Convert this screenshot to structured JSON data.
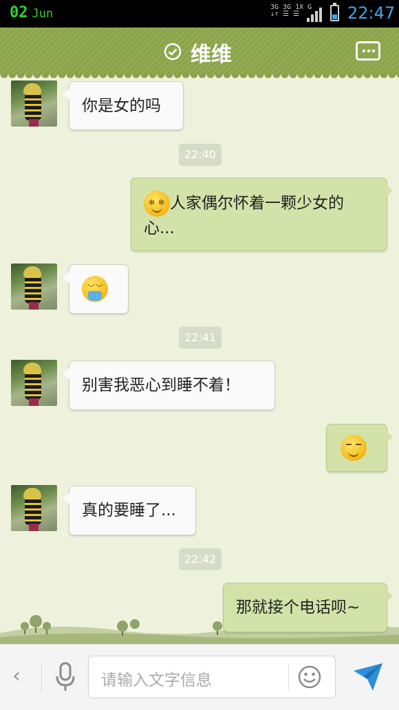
{
  "status_bar": {
    "day": "02",
    "month": "Jun",
    "network": "3G 3G 1X G",
    "time": "22:47"
  },
  "header": {
    "title": "维维",
    "menu_icon": "more-dots-icon",
    "verified_icon": "check-circle-icon",
    "accent": "#8aa34a"
  },
  "messages": [
    {
      "side": "left",
      "text": "你是女的吗"
    },
    {
      "timestamp": "22:40"
    },
    {
      "side": "right",
      "emoji": "dizzy-face",
      "text_line1": "人家偶尔怀着一颗少女的",
      "text_line2": "心..."
    },
    {
      "side": "left",
      "emoji": "vomit-face"
    },
    {
      "timestamp": "22:41"
    },
    {
      "side": "left",
      "text": "别害我恶心到睡不着！"
    },
    {
      "side": "right",
      "emoji": "awkward-smile-face"
    },
    {
      "side": "left",
      "text": "真的要睡了..."
    },
    {
      "timestamp": "22:42"
    },
    {
      "side": "right",
      "text": "那就接个电话呗~"
    }
  ],
  "input_bar": {
    "placeholder": "请输入文字信息",
    "back_icon": "chevron-left-icon",
    "voice_icon": "microphone-icon",
    "emoji_icon": "smiley-icon",
    "send_icon": "paper-plane-icon"
  }
}
